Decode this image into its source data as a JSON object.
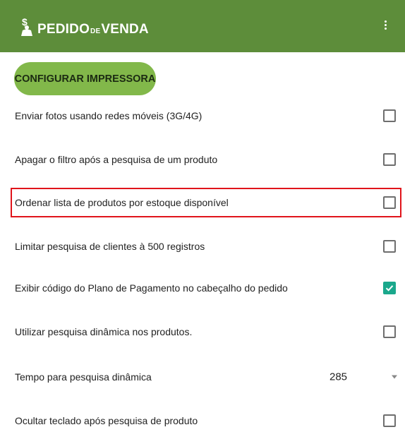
{
  "appbar": {
    "logo_word1": "PEDIDO",
    "logo_word2": "DE",
    "logo_word3": "VENDA",
    "brand_color": "#5d8d3a",
    "logo_icon": "dollar-person-icon",
    "menu_icon": "more-vert-icon"
  },
  "config_button": {
    "label": "CONFIGURAR IMPRESSORA",
    "color": "#82b84a"
  },
  "settings": [
    {
      "label": "Enviar fotos usando redes móveis (3G/4G)",
      "checked": false
    },
    {
      "label": "Apagar o filtro após a pesquisa de um produto",
      "checked": false
    },
    {
      "label": "Ordenar lista de produtos por estoque disponível",
      "checked": false,
      "highlighted": true
    },
    {
      "label": "Limitar pesquisa de clientes à 500 registros",
      "checked": false
    },
    {
      "label": "Exibir código do Plano de Pagamento no cabeçalho do pedido",
      "checked": true
    },
    {
      "label": "Utilizar pesquisa dinâmica nos produtos.",
      "checked": false
    },
    {
      "label": "Tempo para pesquisa dinâmica",
      "type": "select",
      "value": "285"
    },
    {
      "label": "Ocultar teclado após pesquisa de produto",
      "checked": false
    }
  ],
  "colors": {
    "checkbox_checked": "#1aa88c",
    "highlight_border": "#e0141b"
  }
}
